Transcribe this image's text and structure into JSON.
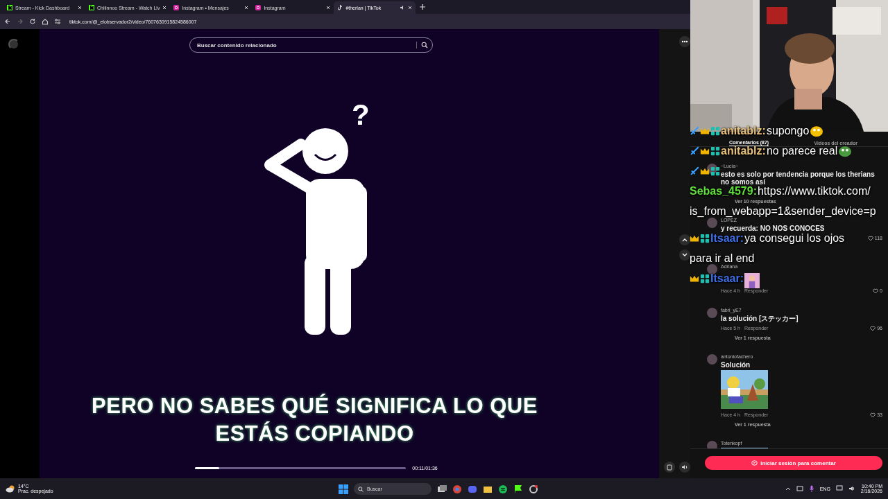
{
  "browser": {
    "tabs": [
      {
        "title": "Stream - Kick Dashboard",
        "kind": "kick",
        "selected": false
      },
      {
        "title": "Chiiinnoo Stream - Watch Liv",
        "kind": "kick",
        "selected": false
      },
      {
        "title": "Instagram • Mensajes",
        "kind": "instagram",
        "selected": false
      },
      {
        "title": "Instagram",
        "kind": "instagram",
        "selected": false
      },
      {
        "title": "#therian | TikTok",
        "kind": "tiktok",
        "selected": true
      }
    ],
    "url": "tiktok.com/@_elobservador2/video/7607630915824586007"
  },
  "video": {
    "search_placeholder": "Buscar contenido relacionado",
    "mark": "?",
    "caption": "PERO NO SABES QUÉ SIGNIFICA LO QUE ESTÁS COPIANDO",
    "progress": {
      "level": 0.115
    },
    "time": "00:11/01:36"
  },
  "comments": {
    "tabs": [
      {
        "label": "Comentarios (87)",
        "selected": true
      },
      {
        "label": "Videos del creador",
        "selected": false
      }
    ],
    "items": [
      {
        "user": "~Lucía~",
        "text": "esto es solo por tendencia porque los therians no somos así",
        "replies": "Ver 10 respuestas"
      },
      {
        "user": "LOPEZ",
        "text": "y recuerda: NO NOS CONOCES",
        "likes": "118"
      },
      {
        "user": "Adriana",
        "time": "Hace 4 h",
        "reply": "Responder",
        "likes": "0"
      },
      {
        "user": "fabri_yE7",
        "text": "la solución [ステッカー]",
        "time": "Hace 5 h",
        "reply": "Responder",
        "likes": "96",
        "replies": "Ver 1 respuesta"
      },
      {
        "user": "antoniofachero",
        "text": "Solución",
        "image": true,
        "time": "Hace 4 h",
        "reply": "Responder",
        "likes": "33",
        "replies": "Ver 1 respuesta"
      },
      {
        "user": "Totenkopf",
        "image": true
      }
    ],
    "login_button": "Iniciar sesión para comentar"
  },
  "chat": {
    "messages": [
      {
        "kind": "moderator",
        "user": "anitablz:",
        "color": "#e8c07a",
        "lines": [
          "supongo"
        ],
        "emote": true
      },
      {
        "kind": "moderator",
        "user": "anitablz:",
        "color": "#e8c07a",
        "lines": [
          "no parece real"
        ],
        "emote": true
      },
      {
        "kind": "moderator"
      },
      {
        "kind": "viewer",
        "user": "Sebas_4579:",
        "color": "#5fe03a",
        "lines": [
          "https://www.tiktok.com/",
          "is_from_webapp=1&sender_device=p"
        ]
      },
      {
        "kind": "subscriber",
        "user": "Itsaar:",
        "color": "#3f6fe8",
        "lines": [
          "ya consegui los ojos",
          "para ir al end"
        ]
      },
      {
        "kind": "subscriber",
        "user": "Itsaar:",
        "color": "#3f6fe8",
        "sticker": true
      }
    ]
  },
  "taskbar": {
    "temp": "14°C",
    "weather": "Prac. despejado",
    "search": "Buscar",
    "lang": "ENG",
    "time": "10:40 PM",
    "date": "2/16/2026"
  }
}
